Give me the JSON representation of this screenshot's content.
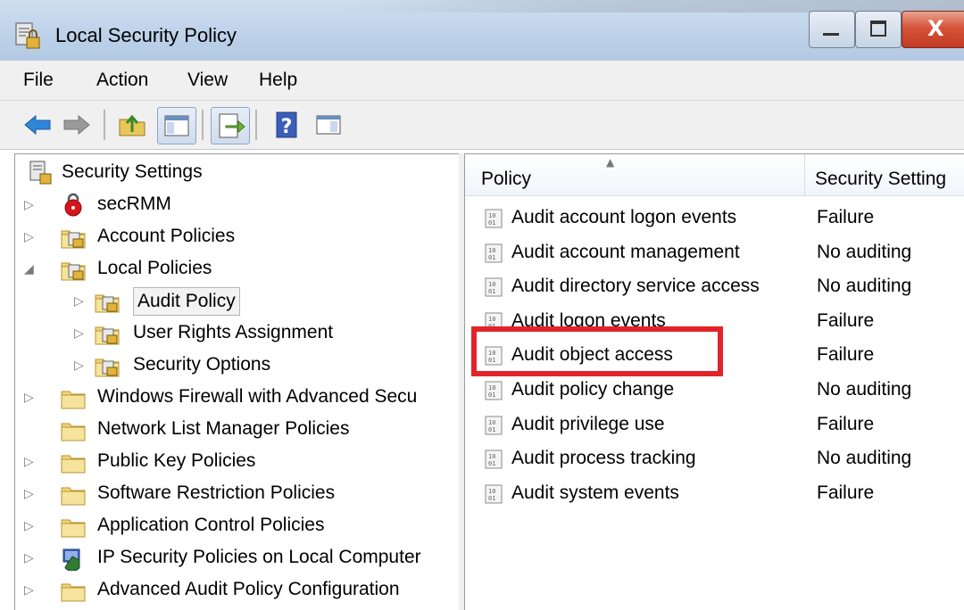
{
  "window": {
    "title": "Local Security Policy",
    "close_glyph": "X"
  },
  "menu": [
    "File",
    "Action",
    "View",
    "Help"
  ],
  "toolbar": {
    "buttons": [
      "back-arrow-icon",
      "forward-arrow-icon",
      "up-folder-icon",
      "show-hide-console-tree-icon",
      "export-list-icon",
      "help-icon",
      "show-hide-action-pane-icon"
    ]
  },
  "tree": {
    "root": "Security Settings",
    "items": [
      {
        "label": "secRMM",
        "icon": "secrmm-lock-icon"
      },
      {
        "label": "Account Policies",
        "icon": "folder-policy-icon"
      },
      {
        "label": "Local Policies",
        "icon": "folder-policy-icon"
      },
      {
        "label": "Audit Policy",
        "icon": "folder-policy-icon"
      },
      {
        "label": "User Rights Assignment",
        "icon": "folder-policy-icon"
      },
      {
        "label": "Security Options",
        "icon": "folder-policy-icon"
      },
      {
        "label": "Windows Firewall with Advanced Secu",
        "icon": "folder-icon"
      },
      {
        "label": "Network List Manager Policies",
        "icon": "folder-icon"
      },
      {
        "label": "Public Key Policies",
        "icon": "folder-icon"
      },
      {
        "label": "Software Restriction Policies",
        "icon": "folder-icon"
      },
      {
        "label": "Application Control Policies",
        "icon": "folder-icon"
      },
      {
        "label": "IP Security Policies on Local Computer",
        "icon": "ip-security-icon"
      },
      {
        "label": "Advanced Audit Policy Configuration",
        "icon": "folder-icon"
      }
    ]
  },
  "list": {
    "columns": [
      "Policy",
      "Security Setting"
    ],
    "rows": [
      {
        "policy": "Audit account logon events",
        "setting": "Failure"
      },
      {
        "policy": "Audit account management",
        "setting": "No auditing"
      },
      {
        "policy": "Audit directory service access",
        "setting": "No auditing"
      },
      {
        "policy": "Audit logon events",
        "setting": "Failure"
      },
      {
        "policy": "Audit object access",
        "setting": "Failure"
      },
      {
        "policy": "Audit policy change",
        "setting": "No auditing"
      },
      {
        "policy": "Audit privilege use",
        "setting": "Failure"
      },
      {
        "policy": "Audit process tracking",
        "setting": "No auditing"
      },
      {
        "policy": "Audit system events",
        "setting": "Failure"
      }
    ],
    "highlighted_row": "Audit object access",
    "highlight_color": "#e3232a"
  }
}
